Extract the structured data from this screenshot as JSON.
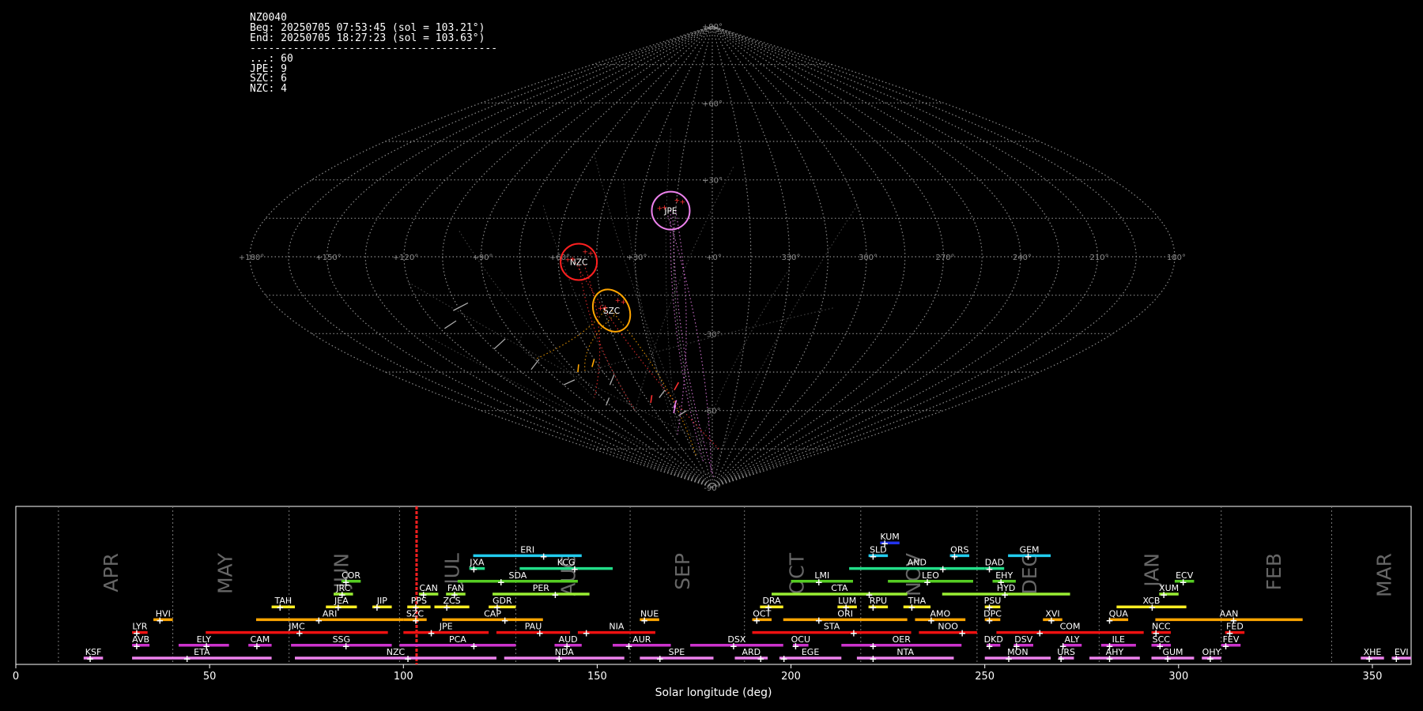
{
  "stats": {
    "lines": [
      "NZ0040",
      "Beg: 20250705 07:53:45 (sol = 103.21°)",
      "End: 20250705 18:27:23 (sol = 103.63°)",
      "----------------------------------------",
      "...: 60",
      "JPE: 9",
      "SZC: 6",
      "NZC: 4"
    ]
  },
  "chart_data": [
    {
      "type": "scatter",
      "title": "",
      "projection": "sinusoidal",
      "grid": true,
      "lon_labels": [
        "+180°",
        "+150°",
        "+120°",
        "+90°",
        "+60°",
        "+30°",
        "+0°",
        "330°",
        "300°",
        "270°",
        "240°",
        "210°",
        "180°"
      ],
      "lat_labels": [
        "+90°",
        "+60°",
        "+30°",
        "-30°",
        "-60°",
        "-90°"
      ],
      "radiants": [
        {
          "name": "JPE",
          "color": "#ee82ee",
          "lon": -17,
          "lat": 18
        },
        {
          "name": "NZC",
          "color": "#ff2020",
          "lon": -52,
          "lat": -2
        },
        {
          "name": "SZC",
          "color": "#ffa500",
          "lon": -42,
          "lat": -21
        }
      ]
    },
    {
      "type": "gantt",
      "xlabel": "Solar longitude (deg)",
      "xlim": [
        0,
        360
      ],
      "x_ticks": [
        0,
        50,
        100,
        150,
        200,
        250,
        300,
        350
      ],
      "current_sol": 103.4,
      "months": [
        {
          "name": "APR",
          "start": 11
        },
        {
          "name": "MAY",
          "start": 40.5
        },
        {
          "name": "JUN",
          "start": 70.5
        },
        {
          "name": "JUL",
          "start": 99
        },
        {
          "name": "AUG",
          "start": 129
        },
        {
          "name": "SEP",
          "start": 158.5
        },
        {
          "name": "OCT",
          "start": 188
        },
        {
          "name": "NOV",
          "start": 218
        },
        {
          "name": "DEC",
          "start": 248
        },
        {
          "name": "JAN",
          "start": 279.5
        },
        {
          "name": "FEB",
          "start": 311
        },
        {
          "name": "MAR",
          "start": 339.5
        }
      ],
      "showers": [
        {
          "name": "KSF",
          "start": 17.5,
          "end": 22.5,
          "peak": 20,
          "row": 0,
          "color": "#ee82ee"
        },
        {
          "name": "ETA",
          "start": 30,
          "end": 66,
          "peak": 45,
          "row": 0,
          "color": "#ee82ee"
        },
        {
          "name": "NZC",
          "start": 72,
          "end": 124,
          "peak": 102,
          "row": 0,
          "color": "#ee82ee"
        },
        {
          "name": "NDA",
          "start": 126,
          "end": 157,
          "peak": 141,
          "row": 0,
          "color": "#ee82ee"
        },
        {
          "name": "SPE",
          "start": 161,
          "end": 180,
          "peak": 167,
          "row": 0,
          "color": "#ee82ee"
        },
        {
          "name": "ARD",
          "start": 185.5,
          "end": 194,
          "peak": 193,
          "row": 0,
          "color": "#ee82ee"
        },
        {
          "name": "EGE",
          "start": 197,
          "end": 213,
          "peak": 199,
          "row": 0,
          "color": "#ee82ee"
        },
        {
          "name": "NTA",
          "start": 217,
          "end": 242,
          "peak": 222,
          "row": 0,
          "color": "#ee82ee"
        },
        {
          "name": "MON",
          "start": 250,
          "end": 267,
          "peak": 257,
          "row": 0,
          "color": "#ee82ee"
        },
        {
          "name": "URS",
          "start": 269,
          "end": 273,
          "peak": 270.5,
          "row": 0,
          "color": "#ee82ee"
        },
        {
          "name": "AHY",
          "start": 277,
          "end": 290,
          "peak": 283,
          "row": 0,
          "color": "#ee82ee"
        },
        {
          "name": "GUM",
          "start": 293,
          "end": 304,
          "peak": 298,
          "row": 0,
          "color": "#ee82ee"
        },
        {
          "name": "OHY",
          "start": 306,
          "end": 311,
          "peak": 309,
          "row": 0,
          "color": "#ee82ee"
        },
        {
          "name": "XHE",
          "start": 347,
          "end": 353,
          "peak": 350,
          "row": 0,
          "color": "#ee82ee"
        },
        {
          "name": "EVI",
          "start": 355,
          "end": 360,
          "peak": 357,
          "row": 0,
          "color": "#ee82ee"
        },
        {
          "name": "AVB",
          "start": 30,
          "end": 34.5,
          "peak": 32,
          "row": 1,
          "color": "#cc33cc"
        },
        {
          "name": "ELY",
          "start": 42,
          "end": 55,
          "peak": 50,
          "row": 1,
          "color": "#cc33cc"
        },
        {
          "name": "CAM",
          "start": 60,
          "end": 66,
          "peak": 63,
          "row": 1,
          "color": "#cc33cc"
        },
        {
          "name": "SSG",
          "start": 71,
          "end": 97,
          "peak": 86,
          "row": 1,
          "color": "#cc33cc"
        },
        {
          "name": "PCA",
          "start": 99,
          "end": 129,
          "peak": 119,
          "row": 1,
          "color": "#cc33cc"
        },
        {
          "name": "AUD",
          "start": 139,
          "end": 146,
          "peak": 143,
          "row": 1,
          "color": "#cc33cc"
        },
        {
          "name": "AUR",
          "start": 154,
          "end": 169,
          "peak": 159,
          "row": 1,
          "color": "#cc33cc"
        },
        {
          "name": "DSX",
          "start": 174,
          "end": 198,
          "peak": 186,
          "row": 1,
          "color": "#cc33cc"
        },
        {
          "name": "OCU",
          "start": 200.5,
          "end": 204.5,
          "peak": 202,
          "row": 1,
          "color": "#cc33cc"
        },
        {
          "name": "OER",
          "start": 213,
          "end": 244,
          "peak": 222,
          "row": 1,
          "color": "#cc33cc"
        },
        {
          "name": "DKD",
          "start": 250.5,
          "end": 254,
          "peak": 252,
          "row": 1,
          "color": "#cc33cc"
        },
        {
          "name": "DSV",
          "start": 257.5,
          "end": 262.5,
          "peak": 259,
          "row": 1,
          "color": "#cc33cc"
        },
        {
          "name": "ALY",
          "start": 270,
          "end": 275,
          "peak": 271,
          "row": 1,
          "color": "#cc33cc"
        },
        {
          "name": "ILE",
          "start": 280,
          "end": 289,
          "peak": 283,
          "row": 1,
          "color": "#cc33cc"
        },
        {
          "name": "SCC",
          "start": 293,
          "end": 298,
          "peak": 296,
          "row": 1,
          "color": "#cc33cc"
        },
        {
          "name": "FEV",
          "start": 311,
          "end": 316,
          "peak": 313,
          "row": 1,
          "color": "#cc33cc"
        },
        {
          "name": "LYR",
          "start": 30,
          "end": 34,
          "peak": 32,
          "row": 2,
          "color": "#ee1111"
        },
        {
          "name": "JMC",
          "start": 49,
          "end": 96,
          "peak": 74,
          "row": 2,
          "color": "#ee1111"
        },
        {
          "name": "JPE",
          "start": 100,
          "end": 122,
          "peak": 108,
          "row": 2,
          "color": "#ee1111"
        },
        {
          "name": "PAU",
          "start": 124,
          "end": 143,
          "peak": 136,
          "row": 2,
          "color": "#ee1111"
        },
        {
          "name": "NIA",
          "start": 145,
          "end": 165,
          "peak": 148,
          "row": 2,
          "color": "#ee1111"
        },
        {
          "name": "STA",
          "start": 190,
          "end": 231,
          "peak": 217,
          "row": 2,
          "color": "#ee1111"
        },
        {
          "name": "NOO",
          "start": 233,
          "end": 248,
          "peak": 245,
          "row": 2,
          "color": "#ee1111"
        },
        {
          "name": "COM",
          "start": 253,
          "end": 291,
          "peak": 265,
          "row": 2,
          "color": "#ee1111"
        },
        {
          "name": "NCC",
          "start": 293,
          "end": 298,
          "peak": 295,
          "row": 2,
          "color": "#ee1111"
        },
        {
          "name": "FED",
          "start": 312,
          "end": 317,
          "peak": 314,
          "row": 2,
          "color": "#ee1111"
        },
        {
          "name": "HVI",
          "start": 35.5,
          "end": 40.5,
          "peak": 38,
          "row": 3,
          "color": "#ffa500"
        },
        {
          "name": "ARI",
          "start": 62,
          "end": 100,
          "peak": 79,
          "row": 3,
          "color": "#ffa500"
        },
        {
          "name": "SZC",
          "start": 100,
          "end": 106,
          "peak": 104,
          "row": 3,
          "color": "#ffa500"
        },
        {
          "name": "CAP",
          "start": 110,
          "end": 136,
          "peak": 127,
          "row": 3,
          "color": "#ffa500"
        },
        {
          "name": "NUE",
          "start": 161,
          "end": 166,
          "peak": 163,
          "row": 3,
          "color": "#ffa500"
        },
        {
          "name": "OCT",
          "start": 190,
          "end": 195,
          "peak": 192,
          "row": 3,
          "color": "#ffa500"
        },
        {
          "name": "ORI",
          "start": 198,
          "end": 230,
          "peak": 208,
          "row": 3,
          "color": "#ffa500"
        },
        {
          "name": "AMO",
          "start": 232,
          "end": 245,
          "peak": 237,
          "row": 3,
          "color": "#ffa500"
        },
        {
          "name": "DPC",
          "start": 250,
          "end": 254,
          "peak": 252,
          "row": 3,
          "color": "#ffa500"
        },
        {
          "name": "XVI",
          "start": 265,
          "end": 270,
          "peak": 268,
          "row": 3,
          "color": "#ffa500"
        },
        {
          "name": "QUA",
          "start": 282,
          "end": 287,
          "peak": 283,
          "row": 3,
          "color": "#ffa500"
        },
        {
          "name": "AAN",
          "start": 294,
          "end": 332,
          "peak": 315,
          "row": 3,
          "color": "#ffa500"
        },
        {
          "name": "TAH",
          "start": 66,
          "end": 72,
          "peak": 69,
          "row": 4,
          "color": "#ffee22"
        },
        {
          "name": "JEA",
          "start": 80,
          "end": 88,
          "peak": 84,
          "row": 4,
          "color": "#ffee22"
        },
        {
          "name": "JIP",
          "start": 92,
          "end": 97,
          "peak": 94,
          "row": 4,
          "color": "#ffee22"
        },
        {
          "name": "PPS",
          "start": 101,
          "end": 107,
          "peak": 104,
          "row": 4,
          "color": "#ffee22"
        },
        {
          "name": "ZCS",
          "start": 108,
          "end": 117,
          "peak": 112,
          "row": 4,
          "color": "#ffee22"
        },
        {
          "name": "GDR",
          "start": 122,
          "end": 129,
          "peak": 125,
          "row": 4,
          "color": "#ffee22"
        },
        {
          "name": "DRA",
          "start": 192,
          "end": 198,
          "peak": 195,
          "row": 4,
          "color": "#ffee22"
        },
        {
          "name": "LUM",
          "start": 212,
          "end": 217,
          "peak": 215,
          "row": 4,
          "color": "#ffee22"
        },
        {
          "name": "RPU",
          "start": 220,
          "end": 225,
          "peak": 222,
          "row": 4,
          "color": "#ffee22"
        },
        {
          "name": "THA",
          "start": 229,
          "end": 236,
          "peak": 232,
          "row": 4,
          "color": "#ffee22"
        },
        {
          "name": "PSU",
          "start": 250,
          "end": 254,
          "peak": 252,
          "row": 4,
          "color": "#ffee22"
        },
        {
          "name": "XCB",
          "start": 284,
          "end": 302,
          "peak": 294,
          "row": 4,
          "color": "#ffee22"
        },
        {
          "name": "JRC",
          "start": 82,
          "end": 87,
          "peak": 85,
          "row": 5,
          "color": "#99ee33"
        },
        {
          "name": "CAN",
          "start": 104,
          "end": 109,
          "peak": 106,
          "row": 5,
          "color": "#99ee33"
        },
        {
          "name": "FAN",
          "start": 111,
          "end": 116,
          "peak": 114,
          "row": 5,
          "color": "#99ee33"
        },
        {
          "name": "PER",
          "start": 123,
          "end": 148,
          "peak": 140,
          "row": 5,
          "color": "#99ee33"
        },
        {
          "name": "CTA",
          "start": 195,
          "end": 230,
          "peak": 221,
          "row": 5,
          "color": "#99ee33"
        },
        {
          "name": "HYD",
          "start": 239,
          "end": 272,
          "peak": 256,
          "row": 5,
          "color": "#99ee33"
        },
        {
          "name": "XUM",
          "start": 295,
          "end": 300,
          "peak": 297,
          "row": 5,
          "color": "#99ee33"
        },
        {
          "name": "COR",
          "start": 84,
          "end": 89,
          "peak": 86,
          "row": 6,
          "color": "#55cc22"
        },
        {
          "name": "SDA",
          "start": 114,
          "end": 145,
          "peak": 126,
          "row": 6,
          "color": "#55cc22"
        },
        {
          "name": "LMI",
          "start": 200,
          "end": 216,
          "peak": 208,
          "row": 6,
          "color": "#55cc22"
        },
        {
          "name": "LEO",
          "start": 225,
          "end": 247,
          "peak": 236,
          "row": 6,
          "color": "#55cc22"
        },
        {
          "name": "EHY",
          "start": 252,
          "end": 258,
          "peak": 255,
          "row": 6,
          "color": "#55cc22"
        },
        {
          "name": "ECV",
          "start": 299,
          "end": 304,
          "peak": 302,
          "row": 6,
          "color": "#55cc22"
        },
        {
          "name": "JXA",
          "start": 117,
          "end": 121,
          "peak": 119,
          "row": 7,
          "color": "#22dd88"
        },
        {
          "name": "KCG",
          "start": 130,
          "end": 154,
          "peak": 145,
          "row": 7,
          "color": "#22dd88"
        },
        {
          "name": "AND",
          "start": 215,
          "end": 250,
          "peak": 240,
          "row": 7,
          "color": "#22dd88"
        },
        {
          "name": "DAD",
          "start": 250,
          "end": 255,
          "peak": 252,
          "row": 7,
          "color": "#22dd88"
        },
        {
          "name": "ERI",
          "start": 118,
          "end": 146,
          "peak": 137,
          "row": 8,
          "color": "#22ccee"
        },
        {
          "name": "SLD",
          "start": 220,
          "end": 225,
          "peak": 222,
          "row": 8,
          "color": "#22ccee"
        },
        {
          "name": "ORS",
          "start": 241,
          "end": 246,
          "peak": 243,
          "row": 8,
          "color": "#22ccee"
        },
        {
          "name": "GEM",
          "start": 256,
          "end": 267,
          "peak": 262,
          "row": 8,
          "color": "#22ccee"
        },
        {
          "name": "KUM",
          "start": 223,
          "end": 228,
          "peak": 225,
          "row": 9,
          "color": "#2233ee"
        }
      ]
    }
  ]
}
